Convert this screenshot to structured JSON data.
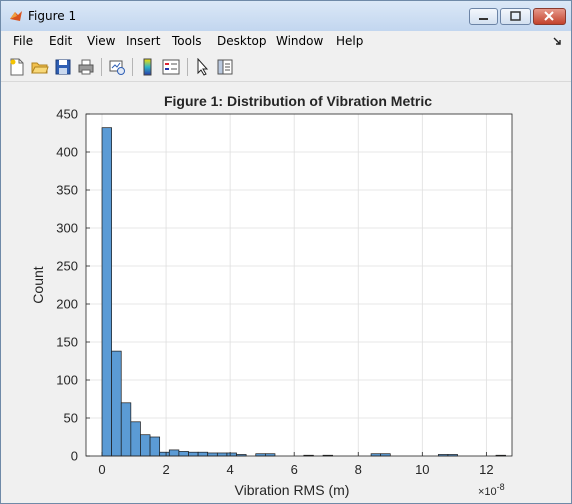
{
  "window": {
    "title": "Figure 1"
  },
  "menu": [
    "File",
    "Edit",
    "View",
    "Insert",
    "Tools",
    "Desktop",
    "Window",
    "Help"
  ],
  "toolbar_icons": [
    "new-figure-icon",
    "open-file-icon",
    "save-icon",
    "print-icon",
    "link-plot-icon",
    "colorbar-icon",
    "legend-icon",
    "pointer-icon",
    "property-editor-icon"
  ],
  "chart_data": {
    "type": "bar",
    "title": "Figure 1: Distribution of Vibration Metric",
    "xlabel": "Vibration RMS (m)",
    "ylabel": "Count",
    "x_exponent_label": "×10",
    "x_exponent": "-8",
    "xlim": [
      -0.5,
      12.8
    ],
    "ylim": [
      0,
      450
    ],
    "xticks": [
      "0",
      "2",
      "4",
      "6",
      "8",
      "10",
      "12"
    ],
    "xtick_values": [
      0,
      2,
      4,
      6,
      8,
      10,
      12
    ],
    "yticks": [
      "0",
      "50",
      "100",
      "150",
      "200",
      "250",
      "300",
      "350",
      "400",
      "450"
    ],
    "ytick_values": [
      0,
      50,
      100,
      150,
      200,
      250,
      300,
      350,
      400,
      450
    ],
    "bin_width": 0.3,
    "bin_start": 0,
    "values": [
      432,
      138,
      70,
      45,
      28,
      25,
      5,
      8,
      6,
      5,
      5,
      4,
      4,
      4,
      2,
      0,
      3,
      3,
      0,
      0,
      0,
      1,
      0,
      1,
      0,
      0,
      0,
      0,
      3,
      3,
      0,
      0,
      0,
      0,
      0,
      2,
      2,
      0,
      0,
      0,
      0,
      1,
      0,
      0,
      0,
      0,
      0,
      0,
      0,
      0,
      0,
      1
    ],
    "bar_color": "#5b9bd5",
    "grid": true
  }
}
